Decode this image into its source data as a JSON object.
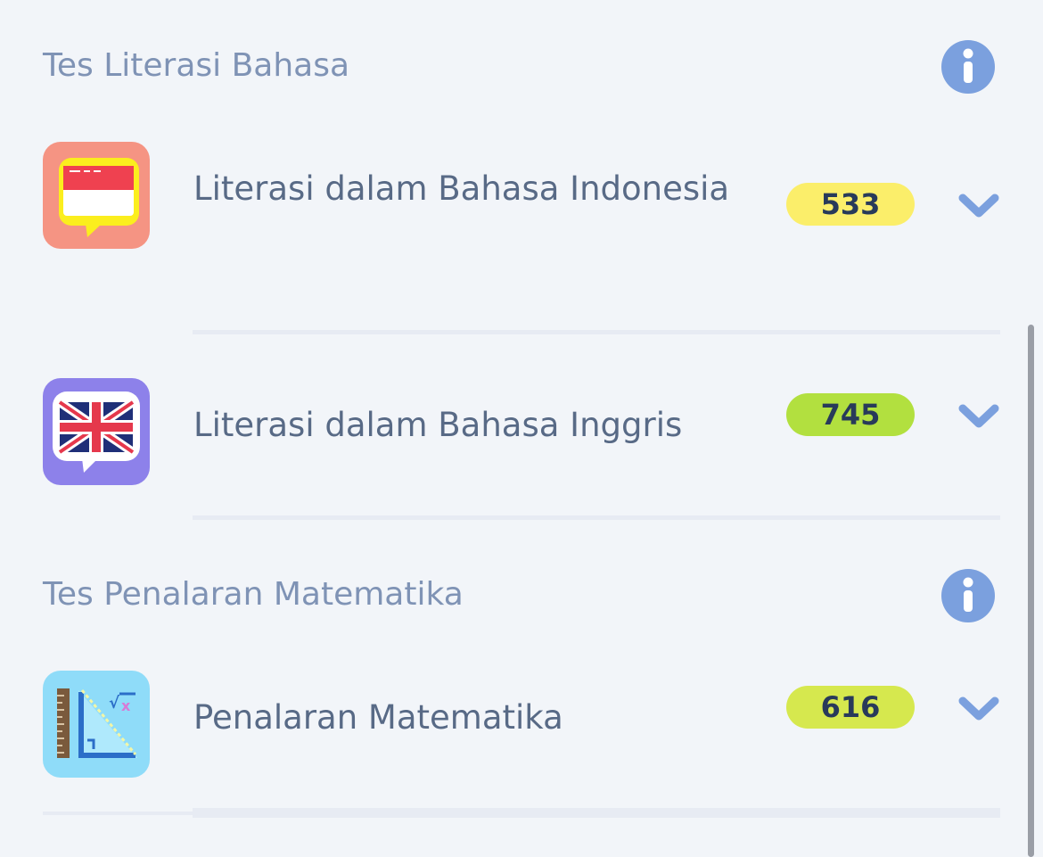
{
  "sections": [
    {
      "title": "Tes Literasi Bahasa",
      "info_icon": "info-icon",
      "items": [
        {
          "label": "Literasi dalam Bahasa Indonesia",
          "score": "533",
          "badge_color": "#fbee6a",
          "icon": "indonesia-flag-icon",
          "icon_bg": "#f59483"
        },
        {
          "label": "Literasi dalam Bahasa Inggris",
          "score": "745",
          "badge_color": "#b2e03f",
          "icon": "uk-flag-icon",
          "icon_bg": "#8d81ea"
        }
      ]
    },
    {
      "title": "Tes Penalaran Matematika",
      "info_icon": "info-icon",
      "items": [
        {
          "label": "Penalaran Matematika",
          "score": "616",
          "badge_color": "#d6e84e",
          "icon": "math-ruler-icon",
          "icon_bg": "#8fdcf9"
        }
      ]
    }
  ],
  "colors": {
    "background": "#f2f5f9",
    "section_title": "#7f93b5",
    "item_text": "#586a86",
    "info_icon": "#7ba0de",
    "chevron": "#7ba0de",
    "badge_text": "#283a5a"
  }
}
